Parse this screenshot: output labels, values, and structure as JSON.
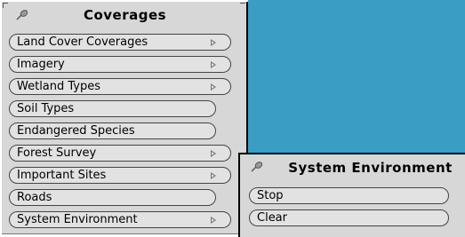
{
  "coverages_menu": {
    "title": "Coverages",
    "items": [
      {
        "label": "Land Cover Coverages",
        "submenu": true
      },
      {
        "label": "Imagery",
        "submenu": true
      },
      {
        "label": "Wetland Types",
        "submenu": true
      },
      {
        "label": "Soil Types",
        "submenu": false
      },
      {
        "label": "Endangered Species",
        "submenu": false
      },
      {
        "label": "Forest Survey",
        "submenu": true
      },
      {
        "label": "Important Sites",
        "submenu": true
      },
      {
        "label": "Roads",
        "submenu": false
      },
      {
        "label": "System Environment",
        "submenu": true
      }
    ]
  },
  "system_environment_menu": {
    "title": "System Environment",
    "items": [
      {
        "label": "Stop"
      },
      {
        "label": "Clear"
      }
    ]
  },
  "colors": {
    "workspace": "#3a9ec4",
    "menu_background": "#d7d7d7",
    "button_background": "#e2e2e2"
  },
  "icons": {
    "pushpin": "pushpin-icon",
    "cascade": "cascade-arrow-icon"
  }
}
